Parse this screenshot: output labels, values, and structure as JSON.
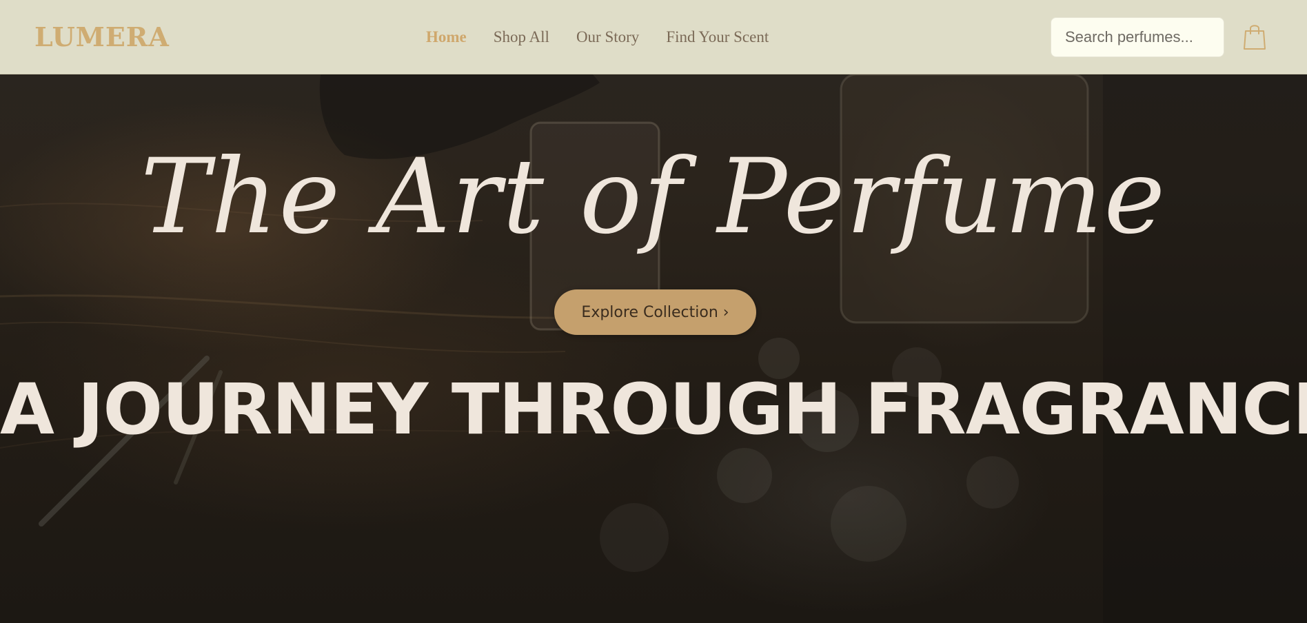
{
  "brand": {
    "name": "LUMERA"
  },
  "nav": {
    "items": [
      {
        "label": "Home",
        "active": true
      },
      {
        "label": "Shop All",
        "active": false
      },
      {
        "label": "Our Story",
        "active": false
      },
      {
        "label": "Find Your Scent",
        "active": false
      }
    ]
  },
  "search": {
    "placeholder": "Search perfumes..."
  },
  "icons": {
    "cart": "shopping-bag-icon"
  },
  "hero": {
    "title": "The Art of Perfume",
    "cta_label": "Explore Collection ›",
    "subtitle": "A JOURNEY THROUGH FRAGRANCE"
  },
  "colors": {
    "header_bg": "#dfddc8",
    "accent": "#cfac72",
    "cta_bg": "#c5a06d",
    "hero_text": "#efe6dc",
    "nav_text": "#7b6a57"
  }
}
